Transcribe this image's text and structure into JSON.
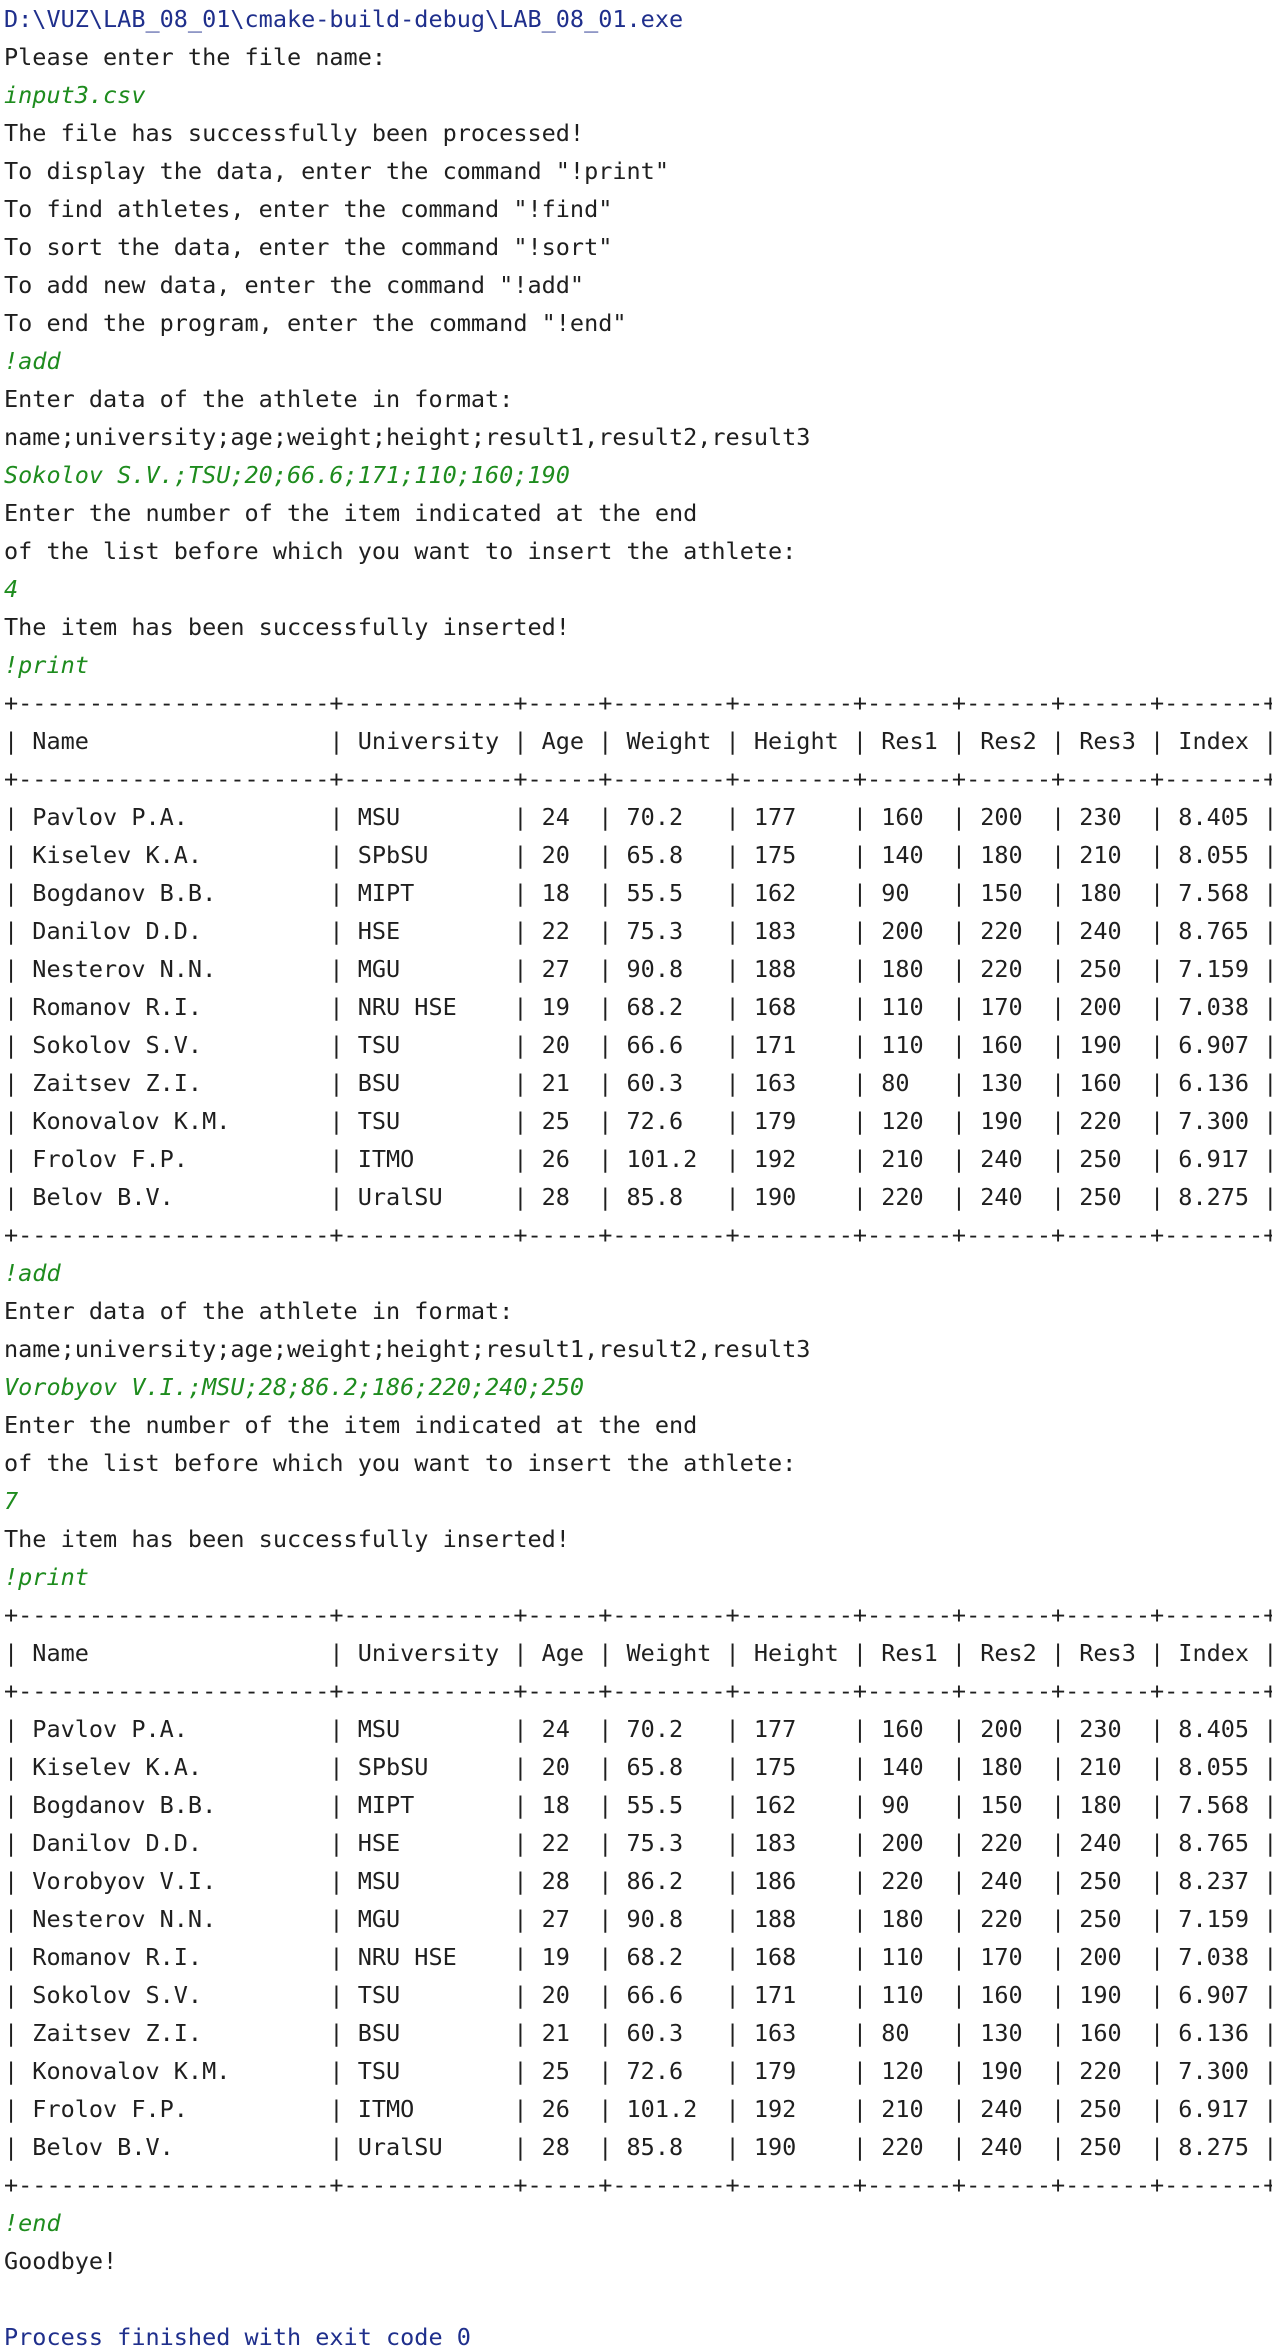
{
  "console": {
    "lines": [
      {
        "type": "sys",
        "text": "D:\\VUZ\\LAB_08_01\\cmake-build-debug\\LAB_08_01.exe"
      },
      {
        "type": "out",
        "text": "Please enter the file name:"
      },
      {
        "type": "input",
        "text": "input3.csv"
      },
      {
        "type": "out",
        "text": "The file has successfully been processed!"
      },
      {
        "type": "out",
        "text": "To display the data, enter the command \"!print\""
      },
      {
        "type": "out",
        "text": "To find athletes, enter the command \"!find\""
      },
      {
        "type": "out",
        "text": "To sort the data, enter the command \"!sort\""
      },
      {
        "type": "out",
        "text": "To add new data, enter the command \"!add\""
      },
      {
        "type": "out",
        "text": "To end the program, enter the command \"!end\""
      },
      {
        "type": "input",
        "text": "!add"
      },
      {
        "type": "out",
        "text": "Enter data of the athlete in format:"
      },
      {
        "type": "out",
        "text": "name;university;age;weight;height;result1,result2,result3"
      },
      {
        "type": "input",
        "text": "Sokolov S.V.;TSU;20;66.6;171;110;160;190"
      },
      {
        "type": "out",
        "text": "Enter the number of the item indicated at the end"
      },
      {
        "type": "out",
        "text": "of the list before which you want to insert the athlete:"
      },
      {
        "type": "input",
        "text": "4"
      },
      {
        "type": "out",
        "text": "The item has been successfully inserted!"
      },
      {
        "type": "input",
        "text": "!print"
      },
      {
        "type": "out",
        "text": "+----------------------+------------+-----+--------+--------+------+------+------+-------+"
      },
      {
        "type": "out",
        "text": "| Name                 | University | Age | Weight | Height | Res1 | Res2 | Res3 | Index |"
      },
      {
        "type": "out",
        "text": "+----------------------+------------+-----+--------+--------+------+------+------+-------+"
      },
      {
        "type": "out",
        "text": "| Pavlov P.A.          | MSU        | 24  | 70.2   | 177    | 160  | 200  | 230  | 8.405 |"
      },
      {
        "type": "out",
        "text": "| Kiselev K.A.         | SPbSU      | 20  | 65.8   | 175    | 140  | 180  | 210  | 8.055 |"
      },
      {
        "type": "out",
        "text": "| Bogdanov B.B.        | MIPT       | 18  | 55.5   | 162    | 90   | 150  | 180  | 7.568 |"
      },
      {
        "type": "out",
        "text": "| Danilov D.D.         | HSE        | 22  | 75.3   | 183    | 200  | 220  | 240  | 8.765 |"
      },
      {
        "type": "out",
        "text": "| Nesterov N.N.        | MGU        | 27  | 90.8   | 188    | 180  | 220  | 250  | 7.159 |"
      },
      {
        "type": "out",
        "text": "| Romanov R.I.         | NRU HSE    | 19  | 68.2   | 168    | 110  | 170  | 200  | 7.038 |"
      },
      {
        "type": "out",
        "text": "| Sokolov S.V.         | TSU        | 20  | 66.6   | 171    | 110  | 160  | 190  | 6.907 |"
      },
      {
        "type": "out",
        "text": "| Zaitsev Z.I.         | BSU        | 21  | 60.3   | 163    | 80   | 130  | 160  | 6.136 |"
      },
      {
        "type": "out",
        "text": "| Konovalov K.M.       | TSU        | 25  | 72.6   | 179    | 120  | 190  | 220  | 7.300 |"
      },
      {
        "type": "out",
        "text": "| Frolov F.P.          | ITMO       | 26  | 101.2  | 192    | 210  | 240  | 250  | 6.917 |"
      },
      {
        "type": "out",
        "text": "| Belov B.V.           | UralSU     | 28  | 85.8   | 190    | 220  | 240  | 250  | 8.275 |"
      },
      {
        "type": "out",
        "text": "+----------------------+------------+-----+--------+--------+------+------+------+-------+"
      },
      {
        "type": "input",
        "text": "!add"
      },
      {
        "type": "out",
        "text": "Enter data of the athlete in format:"
      },
      {
        "type": "out",
        "text": "name;university;age;weight;height;result1,result2,result3"
      },
      {
        "type": "input",
        "text": "Vorobyov V.I.;MSU;28;86.2;186;220;240;250"
      },
      {
        "type": "out",
        "text": "Enter the number of the item indicated at the end"
      },
      {
        "type": "out",
        "text": "of the list before which you want to insert the athlete:"
      },
      {
        "type": "input",
        "text": "7"
      },
      {
        "type": "out",
        "text": "The item has been successfully inserted!"
      },
      {
        "type": "input",
        "text": "!print"
      },
      {
        "type": "out",
        "text": "+----------------------+------------+-----+--------+--------+------+------+------+-------+"
      },
      {
        "type": "out",
        "text": "| Name                 | University | Age | Weight | Height | Res1 | Res2 | Res3 | Index |"
      },
      {
        "type": "out",
        "text": "+----------------------+------------+-----+--------+--------+------+------+------+-------+"
      },
      {
        "type": "out",
        "text": "| Pavlov P.A.          | MSU        | 24  | 70.2   | 177    | 160  | 200  | 230  | 8.405 |"
      },
      {
        "type": "out",
        "text": "| Kiselev K.A.         | SPbSU      | 20  | 65.8   | 175    | 140  | 180  | 210  | 8.055 |"
      },
      {
        "type": "out",
        "text": "| Bogdanov B.B.        | MIPT       | 18  | 55.5   | 162    | 90   | 150  | 180  | 7.568 |"
      },
      {
        "type": "out",
        "text": "| Danilov D.D.         | HSE        | 22  | 75.3   | 183    | 200  | 220  | 240  | 8.765 |"
      },
      {
        "type": "out",
        "text": "| Vorobyov V.I.        | MSU        | 28  | 86.2   | 186    | 220  | 240  | 250  | 8.237 |"
      },
      {
        "type": "out",
        "text": "| Nesterov N.N.        | MGU        | 27  | 90.8   | 188    | 180  | 220  | 250  | 7.159 |"
      },
      {
        "type": "out",
        "text": "| Romanov R.I.         | NRU HSE    | 19  | 68.2   | 168    | 110  | 170  | 200  | 7.038 |"
      },
      {
        "type": "out",
        "text": "| Sokolov S.V.         | TSU        | 20  | 66.6   | 171    | 110  | 160  | 190  | 6.907 |"
      },
      {
        "type": "out",
        "text": "| Zaitsev Z.I.         | BSU        | 21  | 60.3   | 163    | 80   | 130  | 160  | 6.136 |"
      },
      {
        "type": "out",
        "text": "| Konovalov K.M.       | TSU        | 25  | 72.6   | 179    | 120  | 190  | 220  | 7.300 |"
      },
      {
        "type": "out",
        "text": "| Frolov F.P.          | ITMO       | 26  | 101.2  | 192    | 210  | 240  | 250  | 6.917 |"
      },
      {
        "type": "out",
        "text": "| Belov B.V.           | UralSU     | 28  | 85.8   | 190    | 220  | 240  | 250  | 8.275 |"
      },
      {
        "type": "out",
        "text": "+----------------------+------------+-----+--------+--------+------+------+------+-------+"
      },
      {
        "type": "input",
        "text": "!end"
      },
      {
        "type": "out",
        "text": "Goodbye!"
      },
      {
        "type": "blank",
        "text": ""
      },
      {
        "type": "sys",
        "text": "Process finished with exit code 0"
      }
    ]
  },
  "colors": {
    "background": "#ffffff",
    "output_text": "#1f1f1f",
    "user_input": "#1e8c1e",
    "system_text": "#1f2f8c"
  }
}
